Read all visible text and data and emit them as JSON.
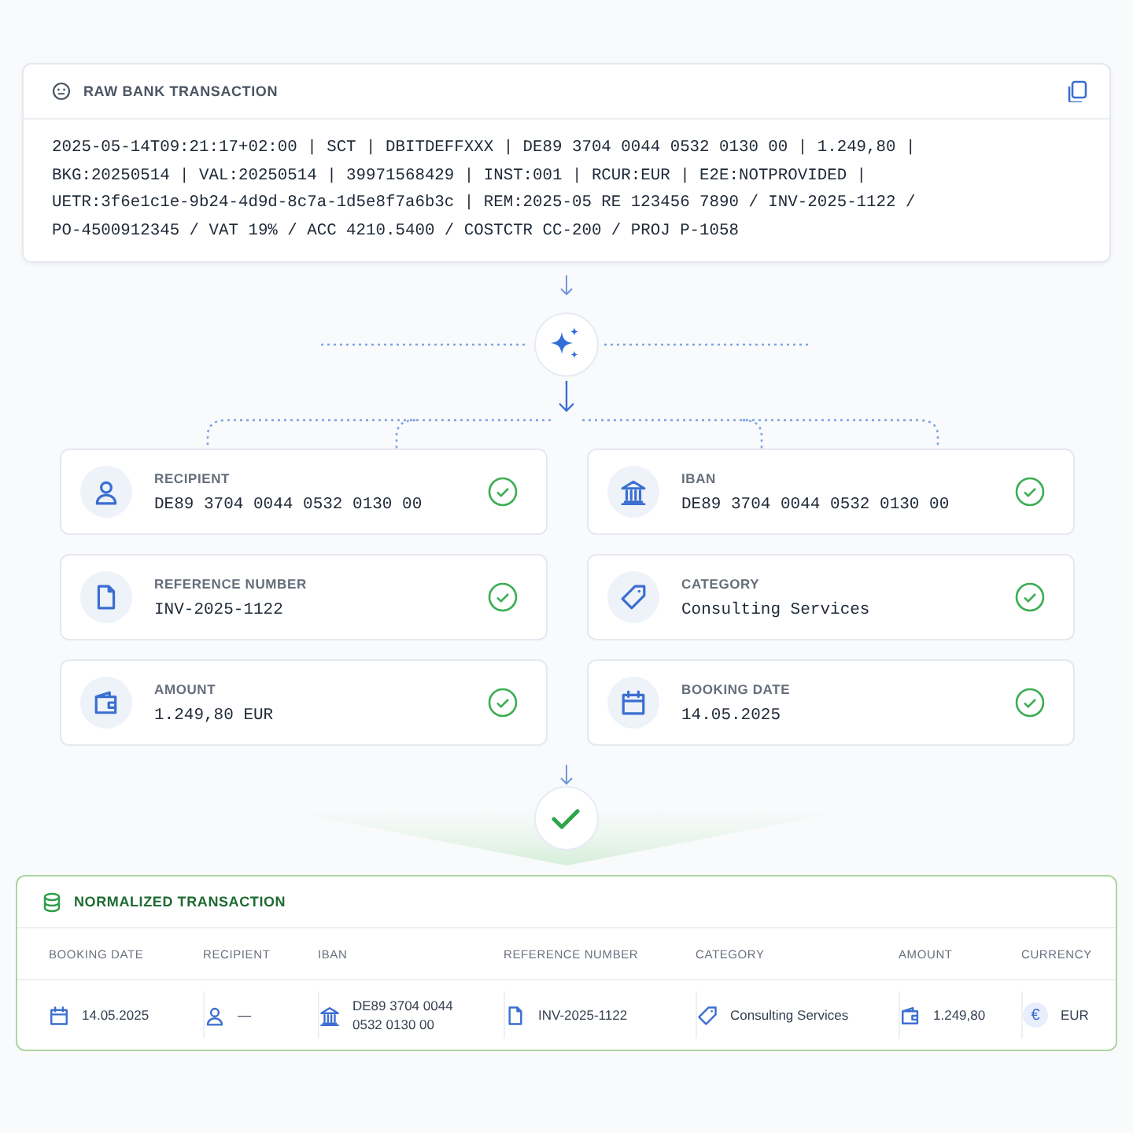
{
  "raw": {
    "title": "RAW BANK TRANSACTION",
    "lines": [
      "2025-05-14T09:21:17+02:00 | SCT | DBITDEFFXXX | DE89 3704 0044 0532 0130 00 | 1.249,80 |",
      "BKG:20250514 | VAL:20250514 | 39971568429 | INST:001 | RCUR:EUR | E2E:NOTPROVIDED |",
      "UETR:3f6e1c1e-9b24-4d9d-8c7a-1d5e8f7a6b3c | REM:2025-05 RE 123456 7890 / INV-2025-1122 /",
      "PO-4500912345 / VAT 19% / ACC 4210.5400 / COSTCTR CC-200 / PROJ P-1058"
    ]
  },
  "fields": [
    {
      "kind": "recipient",
      "label": "RECIPIENT",
      "value": "DE89 3704 0044 0532 0130 00",
      "verified": true
    },
    {
      "kind": "iban",
      "label": "IBAN",
      "value": "DE89 3704 0044 0532 0130 00",
      "verified": true
    },
    {
      "kind": "reference",
      "label": "REFERENCE NUMBER",
      "value": "INV-2025-1122",
      "verified": true
    },
    {
      "kind": "category",
      "label": "CATEGORY",
      "value": "Consulting Services",
      "verified": true
    },
    {
      "kind": "amount",
      "label": "AMOUNT",
      "value": "1.249,80 EUR",
      "verified": true
    },
    {
      "kind": "date",
      "label": "BOOKING DATE",
      "value": "14.05.2025",
      "verified": true
    }
  ],
  "normalized": {
    "title": "NORMALIZED TRANSACTION",
    "columns": [
      "BOOKING DATE",
      "RECIPIENT",
      "IBAN",
      "REFERENCE NUMBER",
      "CATEGORY",
      "AMOUNT",
      "CURRENCY"
    ],
    "row": [
      {
        "kind": "date",
        "value": "14.05.2025"
      },
      {
        "kind": "recipient",
        "value": "—"
      },
      {
        "kind": "iban",
        "value": "DE89 3704 0044 0532 0130 00"
      },
      {
        "kind": "reference",
        "value": "INV-2025-1122"
      },
      {
        "kind": "category",
        "value": "Consulting Services"
      },
      {
        "kind": "amount",
        "value": "1.249,80"
      },
      {
        "kind": "currency",
        "symbol": "€",
        "value": "EUR"
      }
    ]
  }
}
